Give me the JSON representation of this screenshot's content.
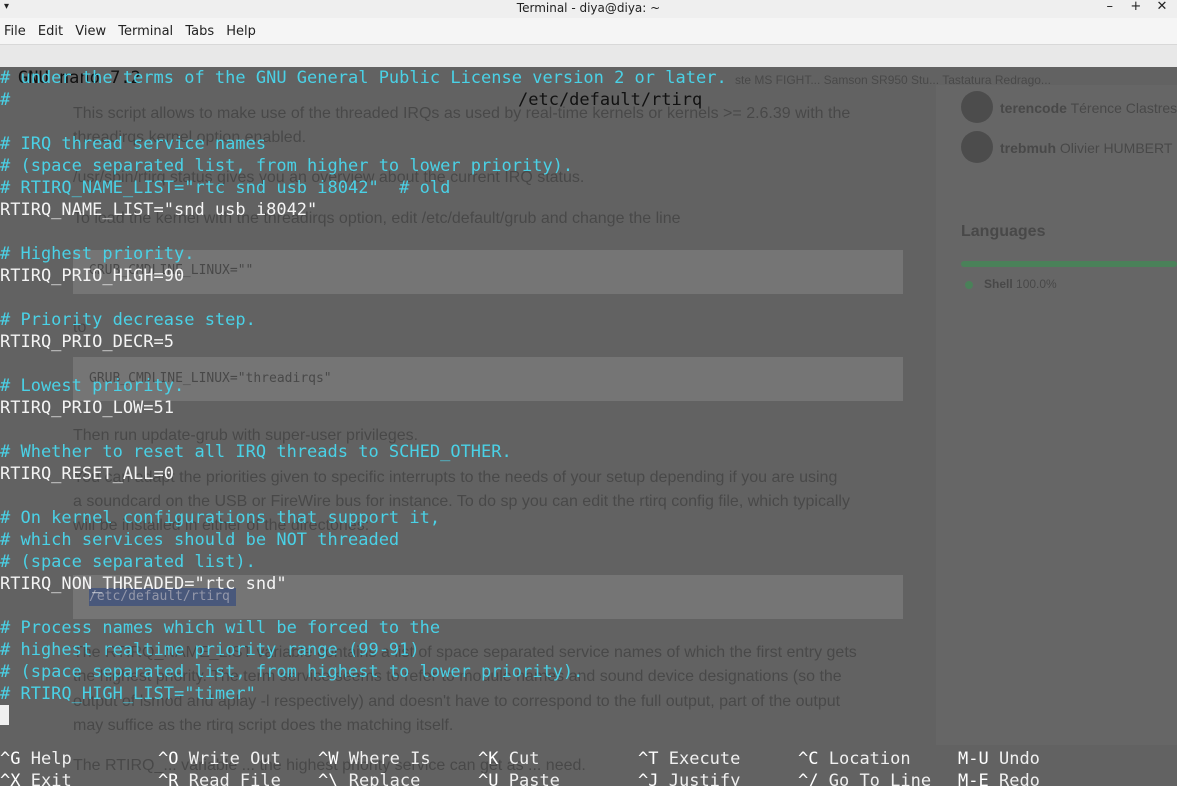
{
  "window": {
    "title": "Terminal - diya@diya: ~",
    "menu_icon": "▾",
    "controls": [
      "–",
      "+",
      "✕"
    ]
  },
  "menubar": [
    "File",
    "Edit",
    "View",
    "Terminal",
    "Tabs",
    "Help"
  ],
  "nano": {
    "version": "GNU nano 7.2",
    "filename": "/etc/default/rtirq",
    "lines": [
      {
        "type": "c",
        "text": "# under the terms of the GNU General Public License version 2 or later."
      },
      {
        "type": "c",
        "text": "#"
      },
      {
        "type": "t",
        "text": ""
      },
      {
        "type": "c",
        "text": "# IRQ thread service names"
      },
      {
        "type": "c",
        "text": "# (space separated list, from higher to lower priority)."
      },
      {
        "type": "c",
        "text": "# RTIRQ_NAME_LIST=\"rtc snd usb i8042\"  # old"
      },
      {
        "type": "t",
        "text": "RTIRQ_NAME_LIST=\"snd usb i8042\""
      },
      {
        "type": "t",
        "text": ""
      },
      {
        "type": "c",
        "text": "# Highest priority."
      },
      {
        "type": "t",
        "text": "RTIRQ_PRIO_HIGH=90"
      },
      {
        "type": "t",
        "text": ""
      },
      {
        "type": "c",
        "text": "# Priority decrease step."
      },
      {
        "type": "t",
        "text": "RTIRQ_PRIO_DECR=5"
      },
      {
        "type": "t",
        "text": ""
      },
      {
        "type": "c",
        "text": "# Lowest priority."
      },
      {
        "type": "t",
        "text": "RTIRQ_PRIO_LOW=51"
      },
      {
        "type": "t",
        "text": ""
      },
      {
        "type": "c",
        "text": "# Whether to reset all IRQ threads to SCHED_OTHER."
      },
      {
        "type": "t",
        "text": "RTIRQ_RESET_ALL=0"
      },
      {
        "type": "t",
        "text": ""
      },
      {
        "type": "c",
        "text": "# On kernel configurations that support it,"
      },
      {
        "type": "c",
        "text": "# which services should be NOT threaded"
      },
      {
        "type": "c",
        "text": "# (space separated list)."
      },
      {
        "type": "t",
        "text": "RTIRQ_NON_THREADED=\"rtc snd\""
      },
      {
        "type": "t",
        "text": ""
      },
      {
        "type": "c",
        "text": "# Process names which will be forced to the"
      },
      {
        "type": "c",
        "text": "# highest realtime priority range (99-91)"
      },
      {
        "type": "c",
        "text": "# (space separated list, from highest to lower priority)."
      },
      {
        "type": "c",
        "text": "# RTIRQ_HIGH_LIST=\"timer\""
      }
    ],
    "shortcuts_row1": [
      {
        "key": "^G",
        "label": "Help"
      },
      {
        "key": "^O",
        "label": "Write Out"
      },
      {
        "key": "^W",
        "label": "Where Is"
      },
      {
        "key": "^K",
        "label": "Cut"
      },
      {
        "key": "^T",
        "label": "Execute"
      },
      {
        "key": "^C",
        "label": "Location"
      },
      {
        "key": "M-U",
        "label": "Undo"
      }
    ],
    "shortcuts_row2": [
      {
        "key": "^X",
        "label": "Exit"
      },
      {
        "key": "^R",
        "label": "Read File"
      },
      {
        "key": "^\\",
        "label": "Replace"
      },
      {
        "key": "^U",
        "label": "Paste"
      },
      {
        "key": "^J",
        "label": "Justify"
      },
      {
        "key": "^/",
        "label": "Go To Line"
      },
      {
        "key": "M-E",
        "label": "Redo"
      }
    ]
  },
  "background_page": {
    "tabs_text": "ste MS FIGHT...    Samson SR950 Stu...    Tastatura Redrago...",
    "paragraphs": [
      "This script allows to make use of the threaded IRQs as used by real-time kernels or kernels >= 2.6.39 with the",
      "threadirqs kernel option enabled.",
      "/usr/sbin/rtirq status gives you an overview about the current IRQ status.",
      "To load the kernel with the threadirqs option, edit /etc/default/grub and change the line",
      "GRUB_CMDLINE_LINUX=\"\"",
      "to",
      "GRUB_CMDLINE_LINUX=\"threadirqs\"",
      "Then run update-grub with super-user privileges.",
      "You can adapt the priorities given to specific interrupts to the needs of your setup depending if you are using",
      "a soundcard on the USB or FireWire bus for instance. To do sp you can edit the rtirq config file, which typically",
      "will be installed in either of the directories:",
      "/etc/default/rtirq",
      "The RTIRQ_NAME_LIST variable contains a list of space separated service names of which the first entry gets",
      "the highest priority. The term service seems to refer to module names and sound device designations (so the",
      "output of lsmod and aplay -l respectively) and doesn't have to correspond to the full output, part of the output",
      "may suffice as the rtirq script does the matching itself.",
      "The RTIRQ_... variable ... the highest priority service can get as ... need."
    ],
    "sidebar": {
      "contributor1_user": "terencode",
      "contributor1_name": "Térence Clastres",
      "contributor2_user": "trebmuh",
      "contributor2_name": "Olivier HUMBERT",
      "languages_heading": "Languages",
      "language": "Shell",
      "language_pct": "100.0%"
    }
  }
}
